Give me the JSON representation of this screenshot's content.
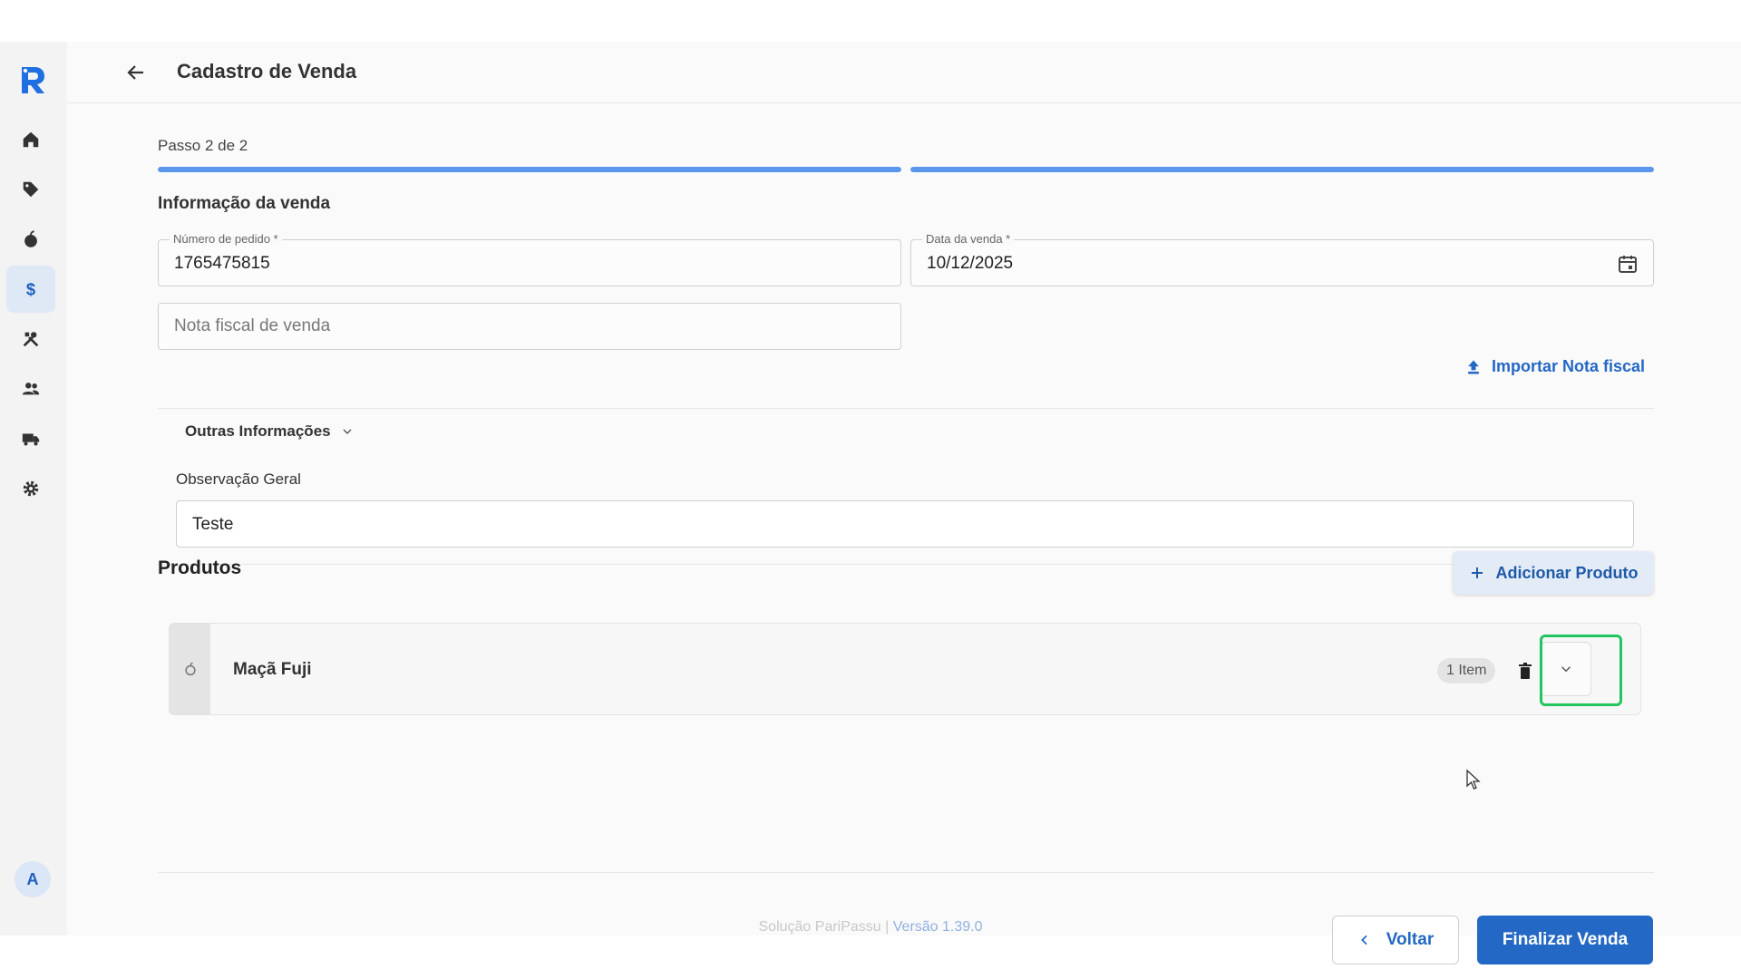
{
  "header": {
    "title": "Cadastro de Venda"
  },
  "sidebar": {
    "items": [
      {
        "icon": "home-icon",
        "active": false
      },
      {
        "icon": "tag-icon",
        "active": false
      },
      {
        "icon": "fruit-icon",
        "active": false
      },
      {
        "icon": "dollar-icon",
        "active": true
      },
      {
        "icon": "tools-icon",
        "active": false
      },
      {
        "icon": "users-icon",
        "active": false
      },
      {
        "icon": "truck-icon",
        "active": false
      },
      {
        "icon": "gear-icon",
        "active": false
      }
    ],
    "avatar": "A"
  },
  "form": {
    "step": "Passo 2 de 2",
    "progress": {
      "current": 2,
      "total": 2
    },
    "section_title": "Informação da venda",
    "order_number": {
      "label": "Número de pedido *",
      "value": "1765475815"
    },
    "sale_date": {
      "label": "Data da venda *",
      "value": "10/12/2025"
    },
    "invoice": {
      "placeholder": "Nota fiscal de venda"
    },
    "import_label": "Importar Nota fiscal",
    "other_info_label": "Outras Informações",
    "observation": {
      "label": "Observação Geral",
      "value": "Teste"
    }
  },
  "products": {
    "title": "Produtos",
    "add_label": "Adicionar Produto",
    "items": [
      {
        "name": "Maçã Fuji",
        "badge": "1 Item"
      }
    ]
  },
  "actions": {
    "back_label": "Voltar",
    "finish_label": "Finalizar Venda"
  },
  "footer": {
    "brand": "Solução PariPassu",
    "separator": "|",
    "version": "Versão 1.39.0"
  },
  "colors": {
    "primary": "#2368c4",
    "progress": "#5a97ec",
    "highlight": "#22c55e"
  }
}
